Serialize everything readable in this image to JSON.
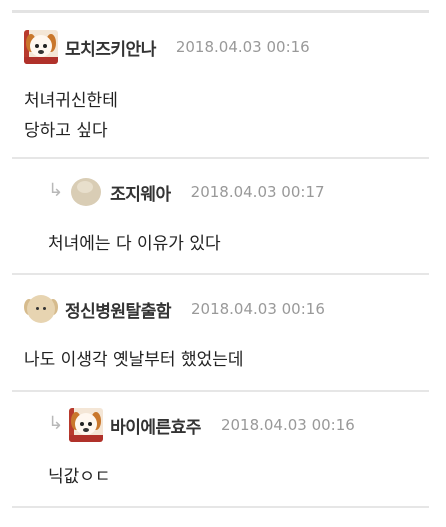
{
  "comments": [
    {
      "nickname": "모치즈키안나",
      "date": "2018.04.03 00:16",
      "lines": [
        "처녀귀신한테",
        "당하고 싶다"
      ],
      "avatar": "puppy-avatar",
      "is_reply": false
    },
    {
      "nickname": "조지웨아",
      "date": "2018.04.03 00:17",
      "lines": [
        "처녀에는 다 이유가 있다"
      ],
      "avatar": "beige-blob-avatar",
      "is_reply": true
    },
    {
      "nickname": "정신병원탈출함",
      "date": "2018.04.03 00:16",
      "lines": [
        "나도 이생각 옛날부터 했었는데"
      ],
      "avatar": "fluffy-dog-avatar",
      "is_reply": false
    },
    {
      "nickname": "바이에른효주",
      "date": "2018.04.03 00:16",
      "lines": [
        "닉값ㅇㄷ"
      ],
      "avatar": "puppy-avatar",
      "is_reply": true
    }
  ],
  "icons": {
    "reply": "reply-arrow-icon"
  },
  "colors": {
    "divider": "#e6e6e6",
    "date": "#999999",
    "reply_arrow": "#b8b8b8"
  }
}
